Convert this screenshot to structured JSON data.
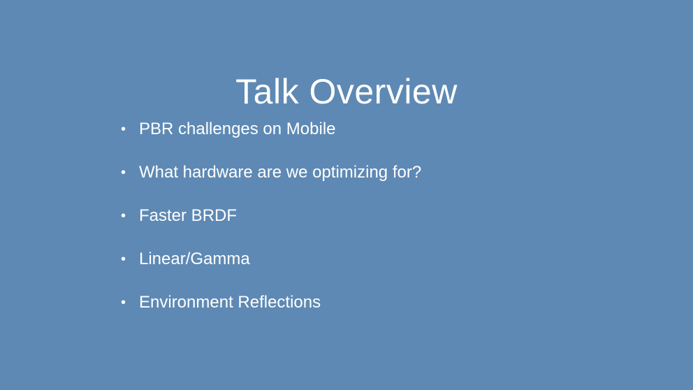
{
  "slide": {
    "title": "Talk Overview",
    "bullet_symbol": "•",
    "bullets": [
      "PBR challenges on Mobile",
      "What hardware are we optimizing for?",
      "Faster BRDF",
      "Linear/Gamma",
      "Environment Reflections"
    ],
    "colors": {
      "background": "#5e89b4",
      "text": "#ffffff"
    }
  }
}
